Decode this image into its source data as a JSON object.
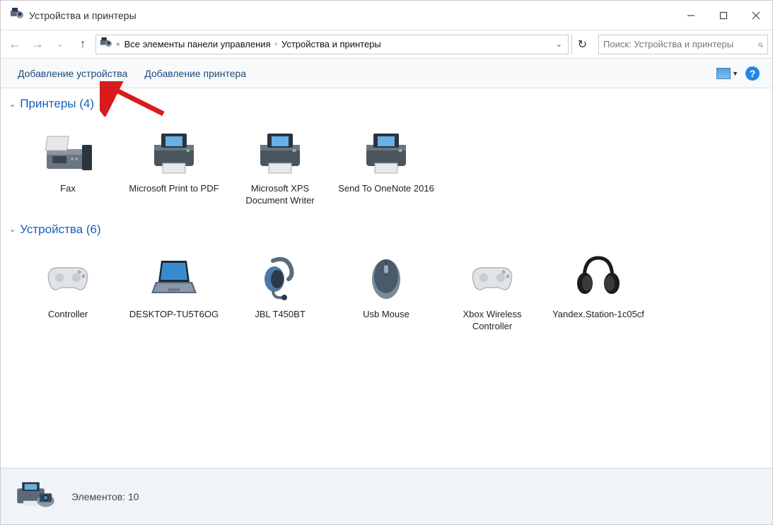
{
  "title": "Устройства и принтеры",
  "breadcrumb": {
    "parent": "Все элементы панели управления",
    "current": "Устройства и принтеры"
  },
  "search": {
    "placeholder": "Поиск: Устройства и принтеры"
  },
  "toolbar": {
    "add_device": "Добавление устройства",
    "add_printer": "Добавление принтера"
  },
  "groups": {
    "printers": {
      "label": "Принтеры (4)",
      "items": [
        {
          "label": "Fax",
          "icon": "fax"
        },
        {
          "label": "Microsoft Print to PDF",
          "icon": "printer"
        },
        {
          "label": "Microsoft XPS Document Writer",
          "icon": "printer"
        },
        {
          "label": "Send To OneNote 2016",
          "icon": "printer"
        }
      ]
    },
    "devices": {
      "label": "Устройства (6)",
      "items": [
        {
          "label": "Controller",
          "icon": "gamepad-light"
        },
        {
          "label": "DESKTOP-TU5T6OG",
          "icon": "laptop"
        },
        {
          "label": "JBL T450BT",
          "icon": "headset"
        },
        {
          "label": "Usb Mouse",
          "icon": "mouse"
        },
        {
          "label": "Xbox Wireless Controller",
          "icon": "gamepad-light"
        },
        {
          "label": "Yandex.Station-1c05cf",
          "icon": "headphones"
        }
      ]
    }
  },
  "status": {
    "count_label": "Элементов: 10"
  }
}
